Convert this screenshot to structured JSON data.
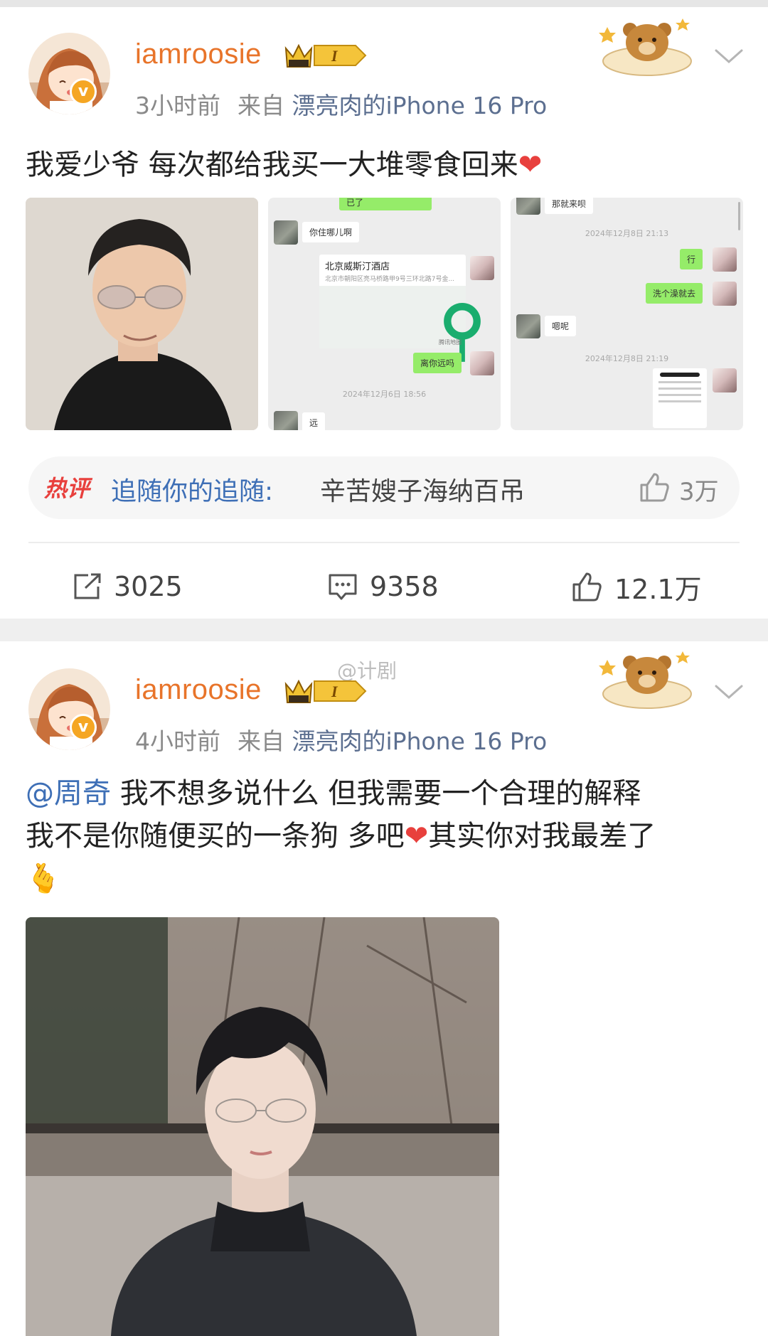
{
  "posts": [
    {
      "username": "iamroosie",
      "level_badge": "I",
      "time": "3小时前",
      "source_prefix": "来自",
      "source": "漂亮肉的iPhone 16 Pro",
      "verified": "v",
      "text": "我爱少爷 每次都给我买一大堆零食回来",
      "text_emoji": "❤",
      "images": {
        "chat1": {
          "top_bubble": "已了",
          "msg1": "你住哪儿啊",
          "location_name": "北京威斯汀酒店",
          "location_addr": "北京市朝阳区亮马桥路甲9号三环北路7号金...",
          "map_label": "腾讯地图",
          "msg2": "离你远吗",
          "timestamp": "2024年12月6日 18:56",
          "msg3": "远"
        },
        "chat2": {
          "top_bubble": "那就来呗",
          "timestamp1": "2024年12月8日 21:13",
          "msg1": "行",
          "msg2": "洗个澡就去",
          "msg3": "嗯呢",
          "timestamp2": "2024年12月8日 21:19"
        }
      },
      "hot_comment": {
        "tag": "热评",
        "author": "追随你的追随:",
        "content": "辛苦嫂子海纳百吊",
        "likes": "3万"
      },
      "actions": {
        "reposts": "3025",
        "comments": "9358",
        "likes": "12.1万"
      }
    },
    {
      "username": "iamroosie",
      "level_badge": "I",
      "time": "4小时前",
      "source_prefix": "来自",
      "source": "漂亮肉的iPhone 16 Pro",
      "verified": "v",
      "watermark": "@计剧",
      "mention": "@周奇",
      "text_line1": "我不想多说什么 但我需要一个合理的解释",
      "text_line2a": "我不是你随便买的一条狗 多吧",
      "text_heart": "❤",
      "text_line2b": "其实你对我最差了",
      "text_line3": "🫰"
    }
  ],
  "colors": {
    "username": "#e8742a",
    "link": "#3e6fb6",
    "hot_tag": "#e8403d",
    "meta": "#8a8a8a",
    "wechat_green": "#95ec69"
  },
  "icons": [
    "repost-icon",
    "comment-icon",
    "like-icon",
    "chevron-down-icon",
    "crown-badge-icon",
    "location-pin-icon"
  ]
}
